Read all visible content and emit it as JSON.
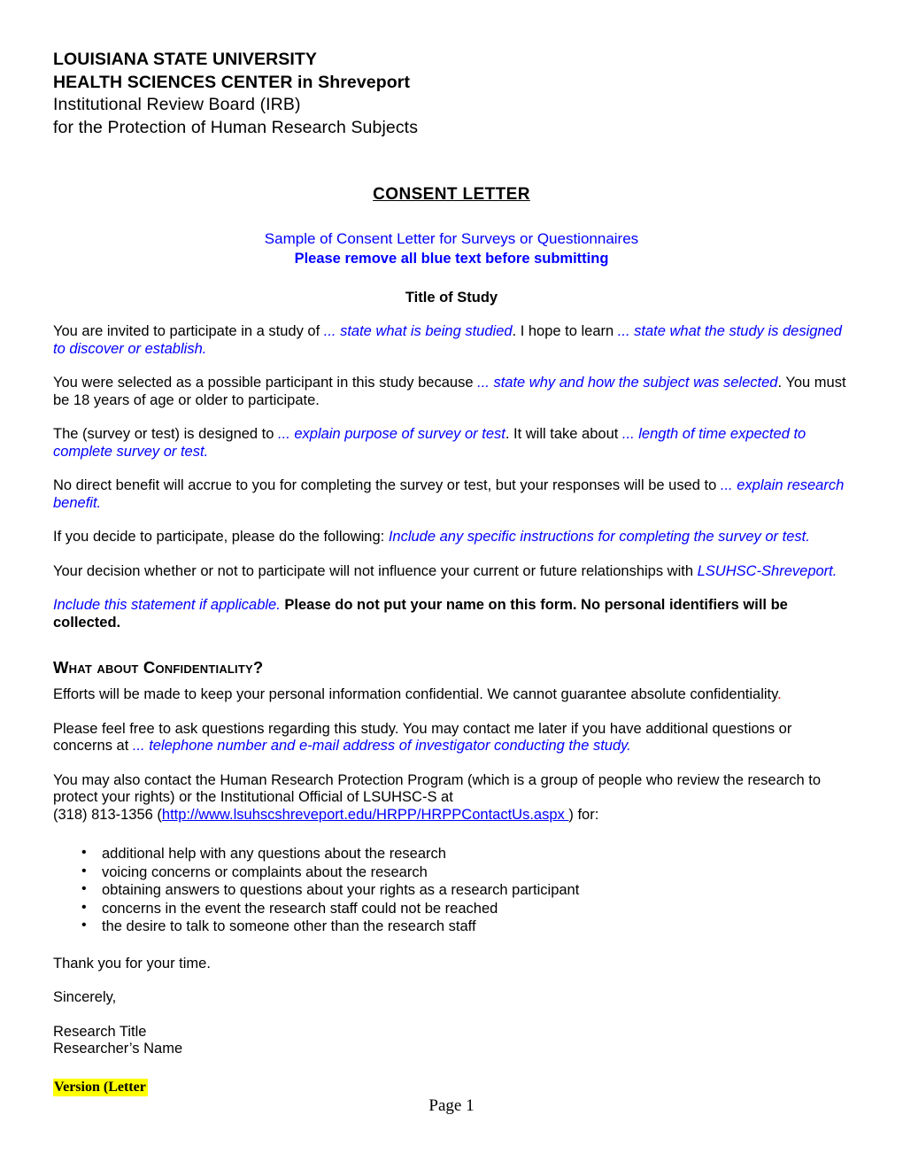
{
  "letterhead": {
    "line1": "LOUISIANA STATE UNIVERSITY",
    "line2": "HEALTH SCIENCES CENTER in Shreveport",
    "line3": "Institutional Review Board (IRB)",
    "line4": "for the Protection of Human Research Subjects"
  },
  "title": {
    "heading": "CONSENT LETTER",
    "sample_note": "Sample of Consent Letter for Surveys or Questionnaires",
    "remove_note": "Please remove all blue text before submitting",
    "study_title": "Title of Study"
  },
  "paragraphs": {
    "p1_a": "You are invited to participate in a study of ",
    "p1_b": "... state what is being studied",
    "p1_c": ". I hope to learn ",
    "p1_d": "... state what the study is designed to discover or establish",
    "p1_e": ".",
    "p2_a": "You were selected as a possible participant in this study because ",
    "p2_b": "... state why and how the subject was selected",
    "p2_c": ". You must be 18 years of age or older to participate.",
    "p3_a": "The (survey or test) is designed to ",
    "p3_b": "... explain purpose of survey or test",
    "p3_c": ". It will take about ",
    "p3_d": "... length of time expected to complete survey or test.",
    "p4_a": "No direct benefit will accrue to you for completing the survey or test, but your responses will be used to ",
    "p4_b": "... explain research benefit.",
    "p5_a": "If you decide to participate, please do the following: ",
    "p5_b": "Include any specific instructions for completing the survey or test.",
    "p6_a": "Your decision whether or not to participate will not influence your current or future relationships with ",
    "p6_b": "LSUHSC-Shreveport.",
    "p7_a": "Include this statement if applicable.",
    "p7_b": " Please do not put your name on this form. No personal identifiers will be collected."
  },
  "confidentiality": {
    "heading": "What about Confidentiality?",
    "efforts_a": "Efforts will be made to keep your personal information confidential.  We cannot guarantee absolute confidentiality",
    "efforts_b": ".",
    "questions_a": "Please feel free to ask questions regarding this study. You may contact me later if you have additional questions or concerns at ",
    "questions_b": "... telephone number and e-mail address of investigator conducting the study.",
    "contact_a": "You may also contact the Human Research Protection Program (which is a group of people who review the research to protect your rights) or the Institutional Official of LSUHSC-S at",
    "contact_phone": "(318) 813-1356 (",
    "contact_link": "http://www.lsuhscshreveport.edu/HRPP/HRPPContactUs.aspx ",
    "contact_after": ") for:"
  },
  "bullets": [
    "additional help with any questions about the research",
    "voicing concerns or complaints about the research",
    "obtaining answers to questions about your rights as a research participant",
    "concerns in the event the research staff could not be reached",
    "the desire to talk to someone other than the research staff"
  ],
  "closing": {
    "thanks": "Thank you for your time.",
    "sincerely": "Sincerely,",
    "research_title": "Research Title",
    "researcher_name": "Researcher’s Name"
  },
  "footer": {
    "version": "Version (Letter",
    "page": "Page 1"
  },
  "colors": {
    "blue": "#0000FF",
    "red": "#FF0000",
    "highlight": "#FFFF00"
  }
}
